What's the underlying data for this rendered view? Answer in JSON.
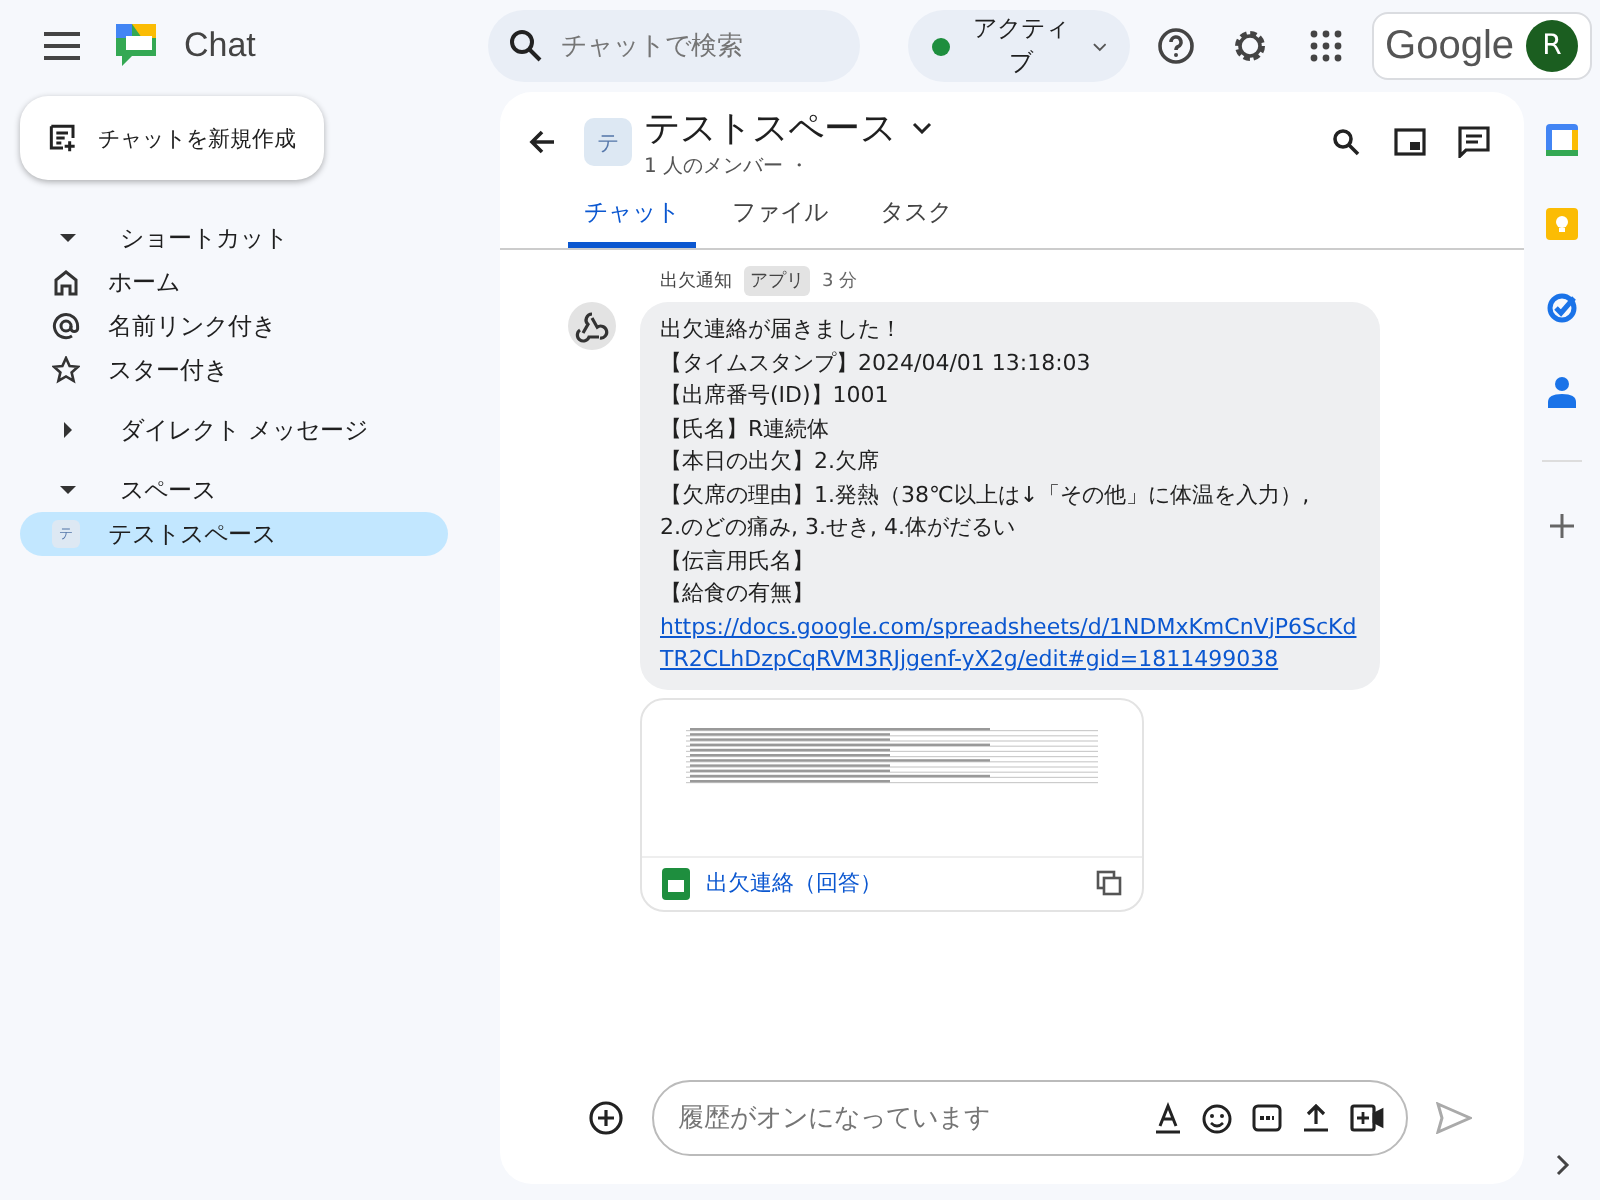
{
  "app": {
    "name": "Chat"
  },
  "search": {
    "placeholder": "チャットで検索"
  },
  "status": {
    "label": "アクティブ",
    "color": "#1e8e3e"
  },
  "account": {
    "brand": "Google",
    "initial": "R"
  },
  "new_chat": {
    "label": "チャットを新規作成"
  },
  "sidebar": {
    "sections": [
      {
        "kind": "section",
        "label": "ショートカット",
        "expanded": true,
        "items": [
          {
            "kind": "home",
            "label": "ホーム",
            "selected": false
          },
          {
            "kind": "mentions",
            "label": "名前リンク付き",
            "selected": false
          },
          {
            "kind": "starred",
            "label": "スター付き",
            "selected": false
          }
        ]
      },
      {
        "kind": "section",
        "label": "ダイレクト メッセージ",
        "expanded": false
      },
      {
        "kind": "section",
        "label": "スペース",
        "expanded": true,
        "items": [
          {
            "kind": "space",
            "label": "テストスペース",
            "avatar": "テ",
            "selected": true
          }
        ]
      }
    ]
  },
  "space": {
    "avatar": "テ",
    "title": "テストスペース",
    "members": "1 人のメンバー ・"
  },
  "tabs": [
    {
      "label": "チャット",
      "selected": true
    },
    {
      "label": "ファイル",
      "selected": false
    },
    {
      "label": "タスク",
      "selected": false
    }
  ],
  "message": {
    "sender": "出欠通知",
    "badge": "アプリ",
    "time": "3 分",
    "lines": [
      "出欠連絡が届きました！",
      "【タイムスタンプ】2024/04/01 13:18:03",
      "【出席番号(ID)】1001",
      "【氏名】R連続体",
      "【本日の出欠】2.欠席",
      "【欠席の理由】1.発熱（38℃以上は↓「その他」に体温を入力）,",
      "2.のどの痛み, 3.せき, 4.体がだるい",
      "【伝言用氏名】",
      "【給食の有無】"
    ],
    "link": "https://docs.google.com/spreadsheets/d/1NDMxKmCnVjP6ScKdTR2CLhDzpCqRVM3RJjgenf-yX2g/edit#gid=1811499038",
    "attachment": {
      "title": "出欠連絡（回答）"
    }
  },
  "compose": {
    "placeholder": "履歴がオンになっています"
  }
}
